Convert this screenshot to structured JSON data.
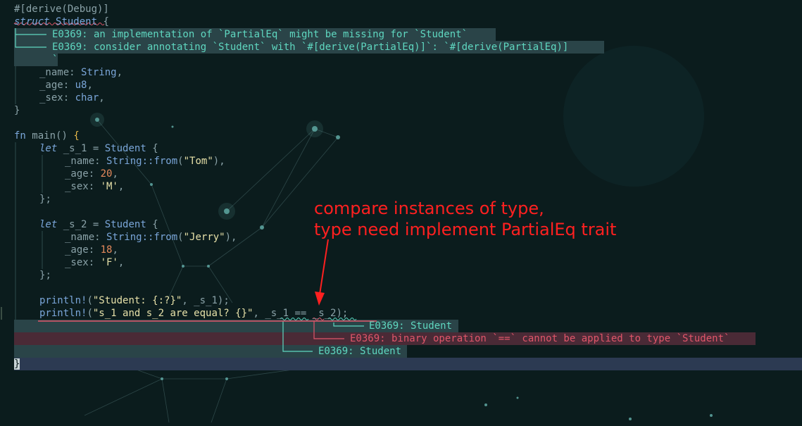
{
  "code": {
    "attr": "#[derive(Debug)]",
    "struct_kw": "struct",
    "struct_name": "Student",
    "brace_open": "{",
    "brace_close": "}",
    "diag1": "E0369: an implementation of `PartialEq` might be missing for `Student`",
    "diag2": "E0369: consider annotating `Student` with `#[derive(PartialEq)]`: `#[derive(PartialEq)]",
    "diag2_cont": "`",
    "field_name": "_name",
    "field_name_type": "String",
    "field_age": "_age",
    "field_age_type": "u8",
    "field_sex": "_sex",
    "field_sex_type": "char",
    "fn_kw": "fn",
    "fn_name": "main",
    "let_kw": "let",
    "var1": "_s_1",
    "var2": "_s_2",
    "string_from": "String::from",
    "name1": "\"Tom\"",
    "age1": "20",
    "sex1": "'M'",
    "name2": "\"Jerry\"",
    "age2": "18",
    "sex2": "'F'",
    "println": "println!",
    "fmt1": "\"Student: {:?}\"",
    "fmt2": "\"s_1 and s_2 are equal? {}\"",
    "op": "==",
    "err_student_a": "E0369: Student",
    "err_binop": "E0369: binary operation `==` cannot be applied to type `Student`",
    "err_student_b": "E0369: Student"
  },
  "annotation": {
    "line1": "compare instances of type,",
    "line2": "type need implement PartialEq trait"
  },
  "colors": {
    "background": "#0b1c1d",
    "annotation": "#ff2020",
    "diag_teal": "#5fd7c0",
    "diag_red": "#e0566a"
  }
}
